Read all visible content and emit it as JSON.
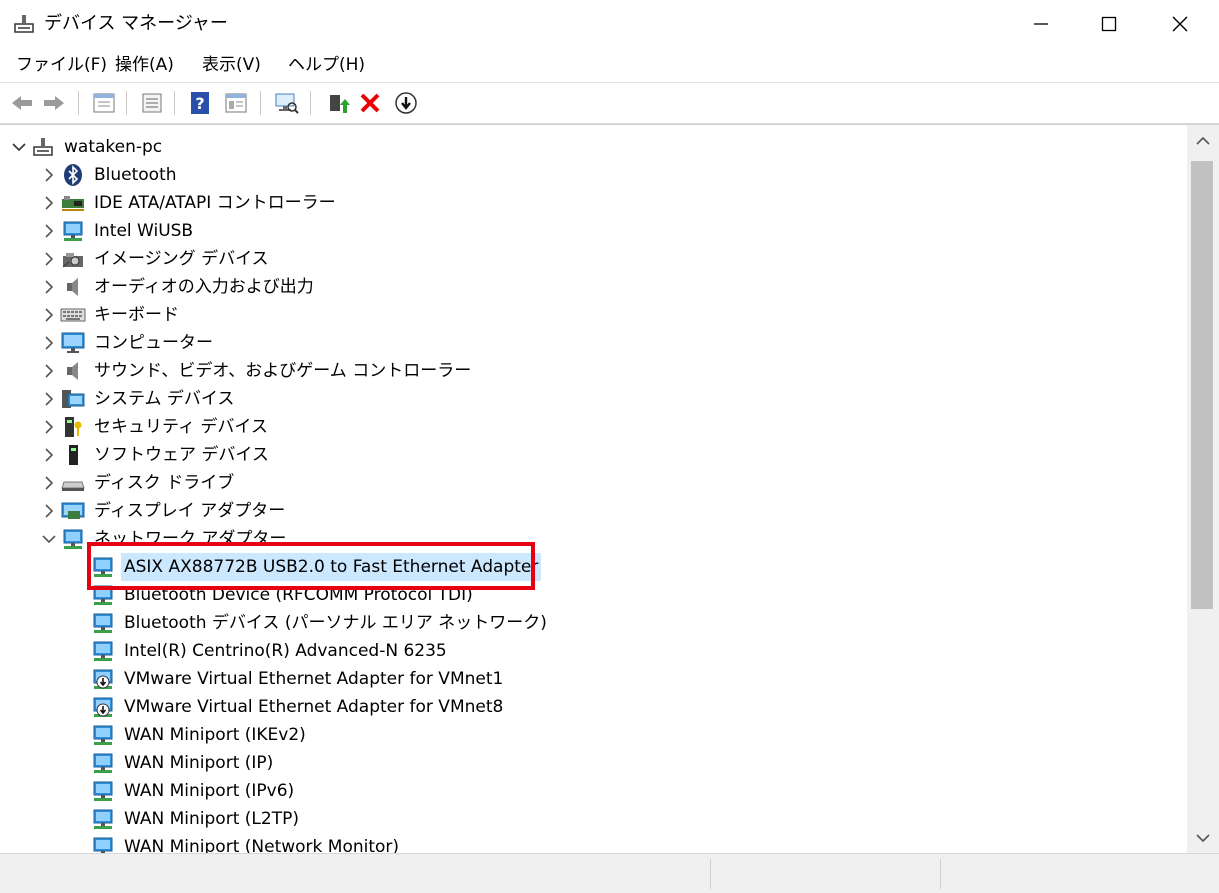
{
  "window": {
    "title": "デバイス マネージャー",
    "controls": [
      "minimize-icon",
      "maximize-icon",
      "close-icon"
    ]
  },
  "menu": {
    "items": [
      "ファイル(F)",
      "操作(A)",
      "表示(V)",
      "ヘルプ(H)"
    ]
  },
  "toolbar": {
    "icons": [
      "back-arrow-icon",
      "forward-arrow-icon",
      "properties-icon",
      "list-icon",
      "help-icon",
      "details-icon",
      "scan-hardware-icon",
      "update-driver-icon",
      "uninstall-icon",
      "disable-device-icon"
    ]
  },
  "tree": {
    "root": "wataken-pc",
    "categories": [
      {
        "label": "Bluetooth",
        "icon": "bluetooth-icon"
      },
      {
        "label": "IDE ATA/ATAPI コントローラー",
        "icon": "ide-controller-icon"
      },
      {
        "label": "Intel WiUSB",
        "icon": "network-icon"
      },
      {
        "label": "イメージング デバイス",
        "icon": "camera-icon"
      },
      {
        "label": "オーディオの入力および出力",
        "icon": "speaker-icon"
      },
      {
        "label": "キーボード",
        "icon": "keyboard-icon"
      },
      {
        "label": "コンピューター",
        "icon": "computer-icon"
      },
      {
        "label": "サウンド、ビデオ、およびゲーム コントローラー",
        "icon": "speaker-icon"
      },
      {
        "label": "システム デバイス",
        "icon": "system-device-icon"
      },
      {
        "label": "セキュリティ デバイス",
        "icon": "security-key-icon"
      },
      {
        "label": "ソフトウェア デバイス",
        "icon": "software-device-icon"
      },
      {
        "label": "ディスク ドライブ",
        "icon": "disk-drive-icon"
      },
      {
        "label": "ディスプレイ アダプター",
        "icon": "display-adapter-icon"
      },
      {
        "label": "ネットワーク アダプター",
        "icon": "network-icon",
        "expanded": true
      }
    ],
    "network_adapters": [
      {
        "label": "ASIX AX88772B USB2.0 to Fast Ethernet Adapter",
        "icon": "network-icon",
        "selected": true
      },
      {
        "label": "Bluetooth Device (RFCOMM Protocol TDI)",
        "icon": "network-icon"
      },
      {
        "label": "Bluetooth デバイス (パーソナル エリア ネットワーク)",
        "icon": "network-icon"
      },
      {
        "label": "Intel(R) Centrino(R) Advanced-N 6235",
        "icon": "network-icon"
      },
      {
        "label": "VMware Virtual Ethernet Adapter for VMnet1",
        "icon": "disabled-network-icon"
      },
      {
        "label": "VMware Virtual Ethernet Adapter for VMnet8",
        "icon": "disabled-network-icon"
      },
      {
        "label": "WAN Miniport (IKEv2)",
        "icon": "network-icon"
      },
      {
        "label": "WAN Miniport (IP)",
        "icon": "network-icon"
      },
      {
        "label": "WAN Miniport (IPv6)",
        "icon": "network-icon"
      },
      {
        "label": "WAN Miniport (L2TP)",
        "icon": "network-icon"
      },
      {
        "label": "WAN Miniport (Network Monitor)",
        "icon": "network-icon"
      }
    ]
  },
  "colors": {
    "selection": "#cce8ff",
    "highlight_box": "#e60012",
    "scrollbar_thumb": "#c1c1c1"
  }
}
